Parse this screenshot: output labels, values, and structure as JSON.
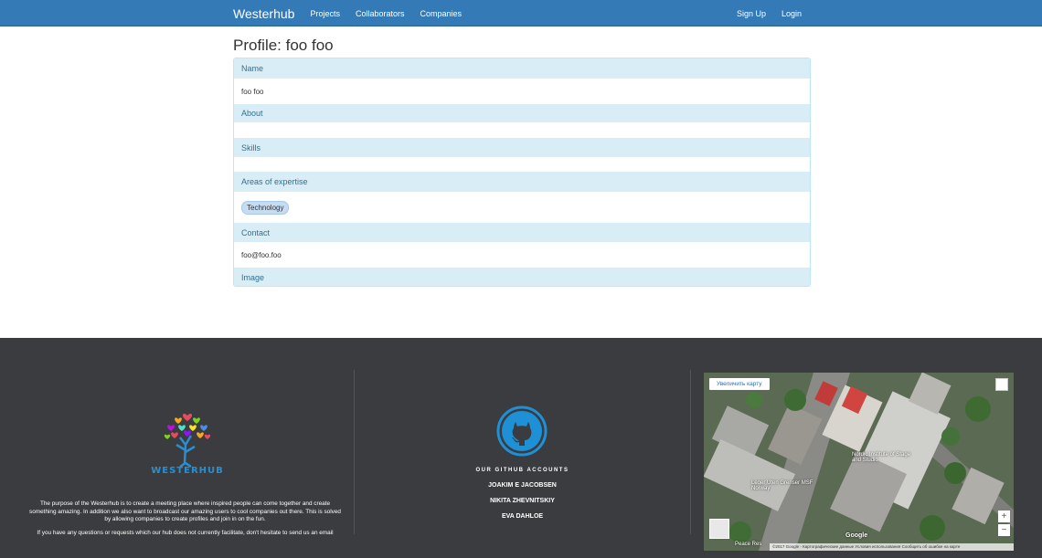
{
  "nav": {
    "brand": "Westerhub",
    "links": [
      "Projects",
      "Collaborators",
      "Companies"
    ],
    "right": [
      "Sign Up",
      "Login"
    ]
  },
  "page": {
    "title": "Profile: foo foo"
  },
  "profile": {
    "name_heading": "Name",
    "name_value": "foo foo",
    "about_heading": "About",
    "skills_heading": "Skills",
    "expertise_heading": "Areas of expertise",
    "expertise_tag": "Technology",
    "contact_heading": "Contact",
    "contact_value": "foo@foo.foo",
    "image_heading": "Image"
  },
  "footer": {
    "logo_text": "WESTERHUB",
    "description": "The purpose of the Westerhub is to create a meeting place where inspired people can come together and create something amazing. In addition we also want to broadcast our amazing users to cool companies out there. This is solved by allowing companies to create profiles and join in on the fun.",
    "contact_note": "If you have any questions or requests which our hub does not currently facilitate, don't hesitate to send us an email",
    "github_title": "OUR GITHUB ACCOUNTS",
    "github_accounts": [
      "JOAKIM E JACOBSEN",
      "NIKITA ZHEVNITSKIY",
      "EVA DAHLOE"
    ]
  },
  "map": {
    "enlarge_button": "Увеличить карту",
    "zoom_in": "+",
    "zoom_out": "−",
    "labels": [
      "Nordic Institute of Stage and Studio",
      "Leger Uten Grenser MSF Norway",
      "Peace Res"
    ],
    "attribution": "©2017 Google - Картографические данные   Условия использования   Сообщить об ошибке на карте",
    "google_logo": "Google"
  },
  "colors": {
    "navbar": "#337ab7",
    "panel_heading_bg": "#d9edf7",
    "panel_heading_text": "#31708f",
    "footer_bg": "#3b3c3f",
    "github_blue": "#1e90d6"
  }
}
